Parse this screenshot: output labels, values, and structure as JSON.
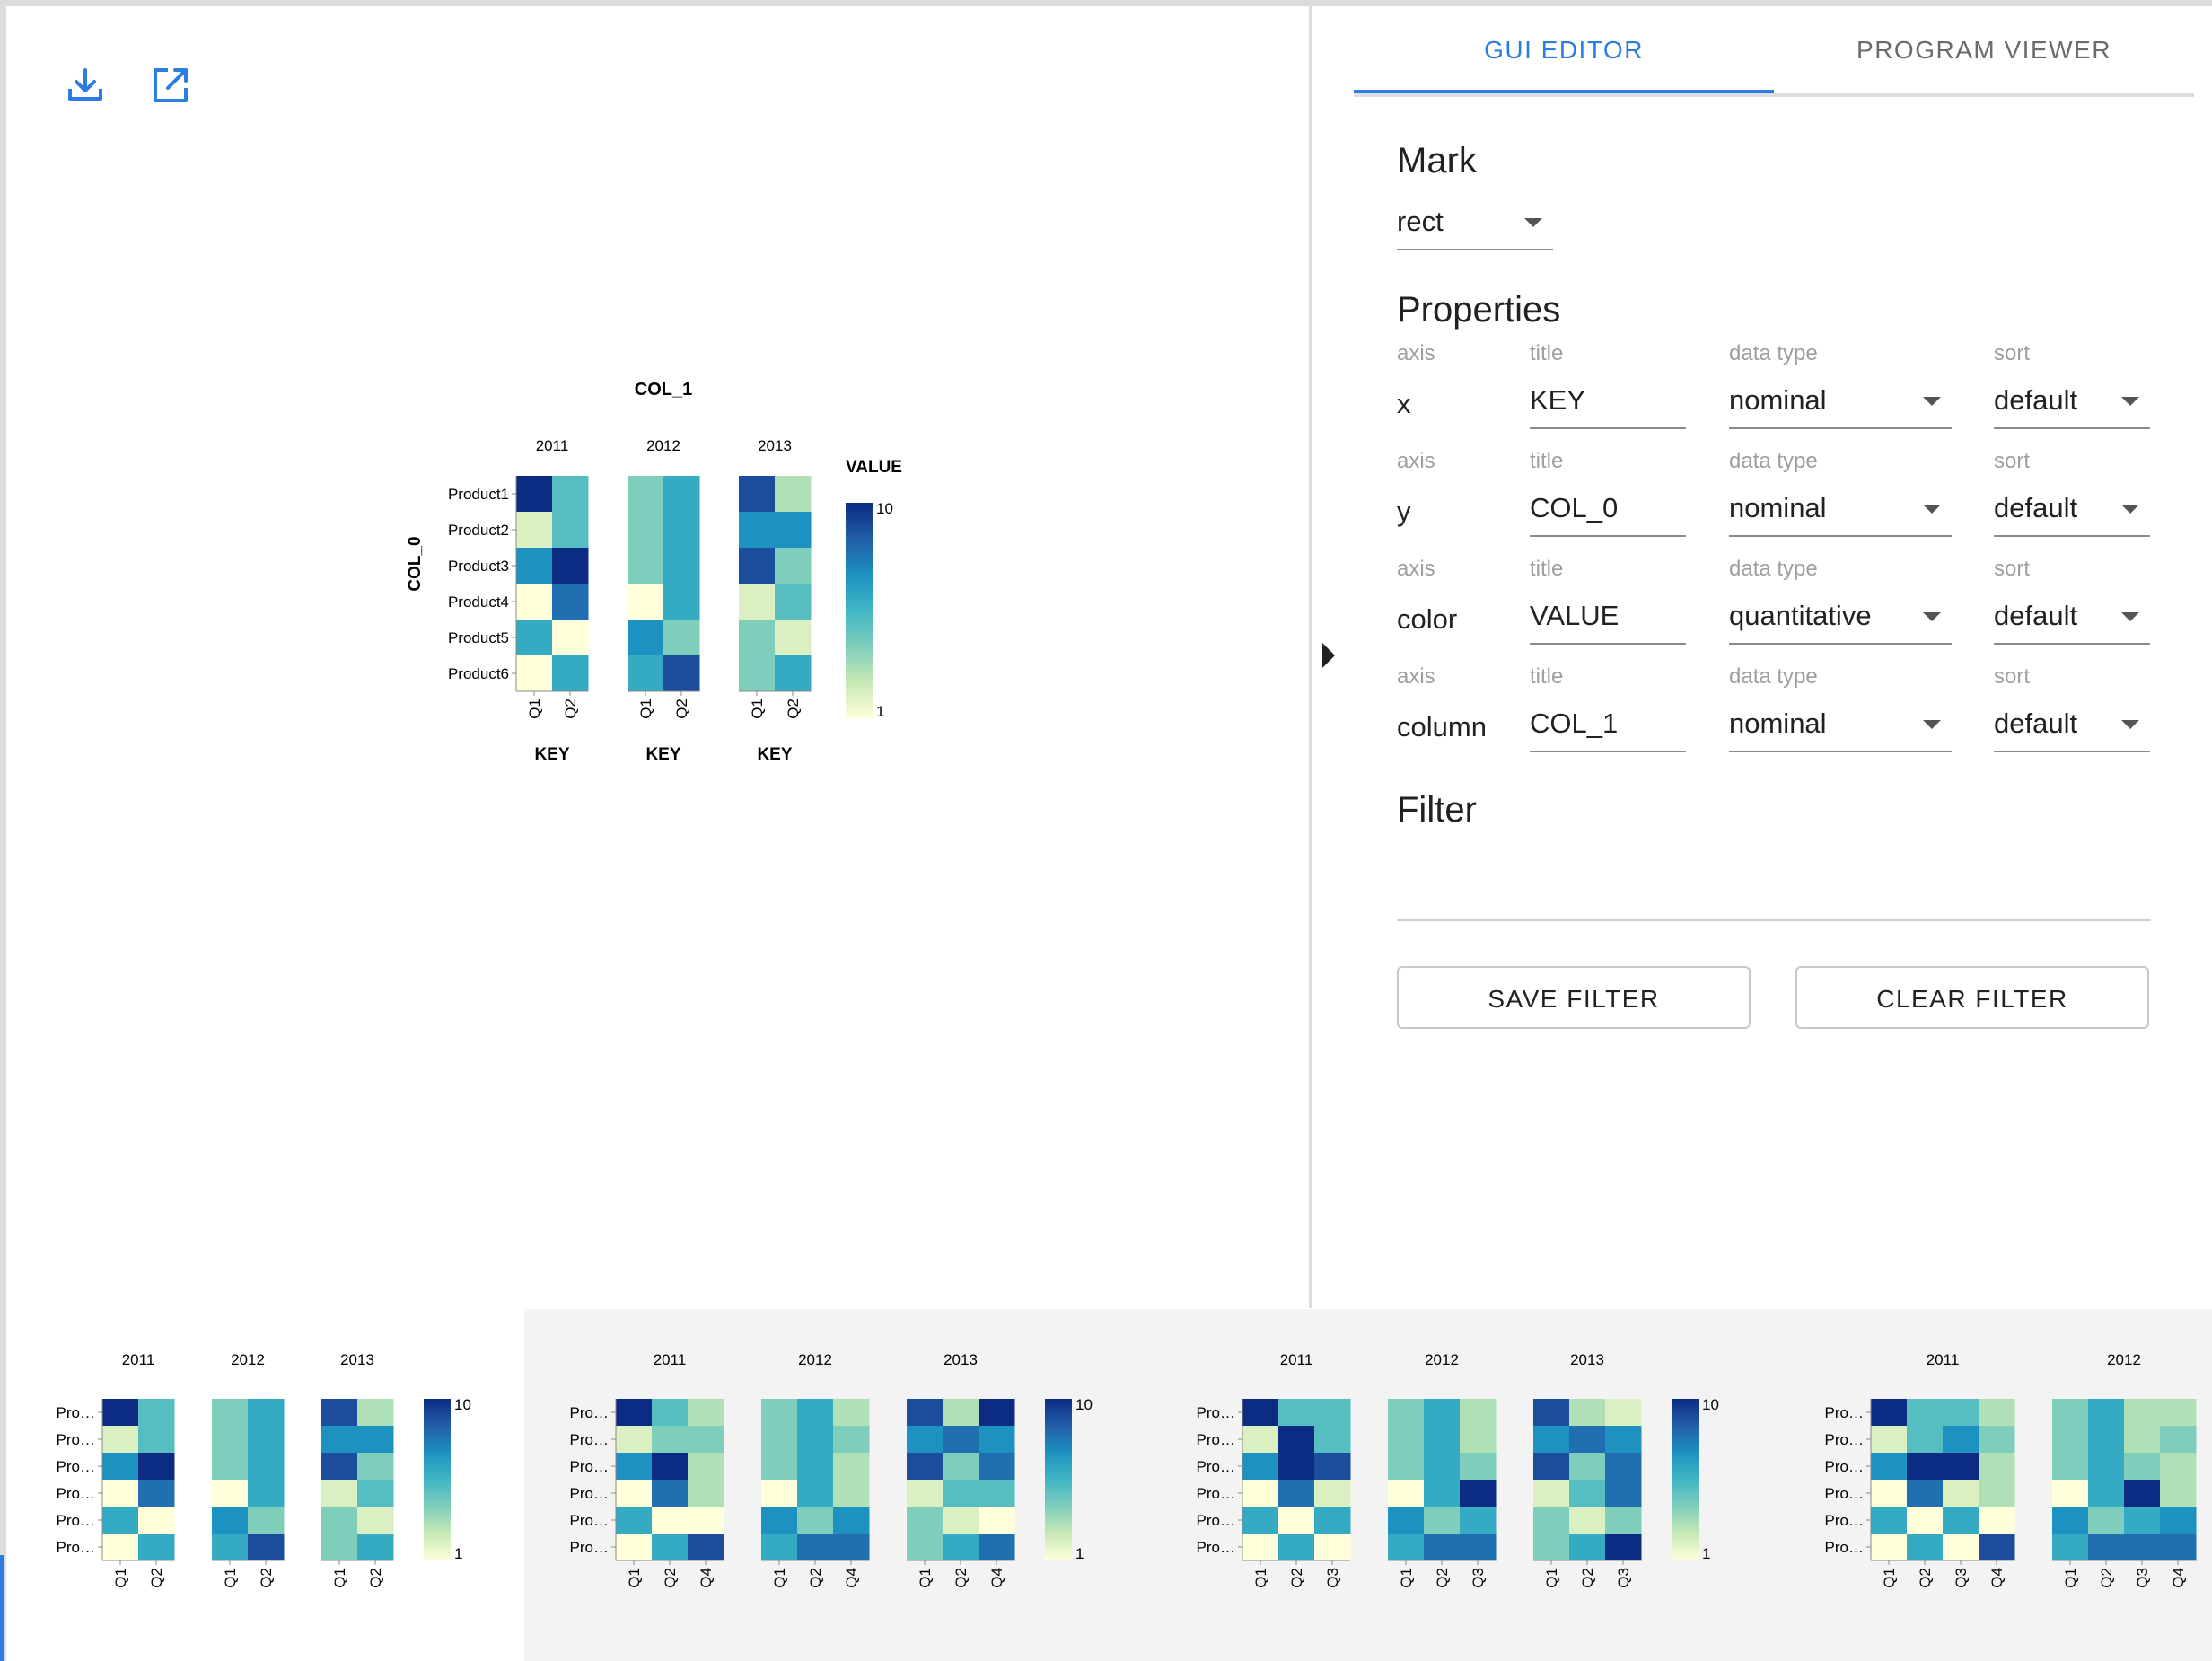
{
  "toolbar": {
    "download_icon": "download-icon",
    "open_icon": "open-in-new-icon",
    "accent": "#2b7de1"
  },
  "tabs": [
    {
      "label": "GUI EDITOR",
      "active": true
    },
    {
      "label": "PROGRAM VIEWER",
      "active": false
    }
  ],
  "editor": {
    "mark_title": "Mark",
    "mark_value": "rect",
    "properties_title": "Properties",
    "col_labels": {
      "axis": "axis",
      "title": "title",
      "data_type": "data type",
      "sort": "sort"
    },
    "rows": [
      {
        "axis": "x",
        "title": "KEY",
        "data_type": "nominal",
        "sort": "default"
      },
      {
        "axis": "y",
        "title": "COL_0",
        "data_type": "nominal",
        "sort": "default"
      },
      {
        "axis": "color",
        "title": "VALUE",
        "data_type": "quantitative",
        "sort": "default"
      },
      {
        "axis": "column",
        "title": "COL_1",
        "data_type": "nominal",
        "sort": "default"
      }
    ],
    "filter_title": "Filter",
    "save_filter": "SAVE FILTER",
    "clear_filter": "CLEAR FILTER"
  },
  "color_scale": [
    "#ffffd9",
    "#c7e9b4",
    "#7fcdbb",
    "#41b6c4",
    "#1d91c0",
    "#225ea8",
    "#0c2c84"
  ],
  "chart_data": {
    "type": "heatmap",
    "title": "COL_1",
    "xlabel": "KEY",
    "ylabel": "COL_0",
    "legend_title": "VALUE",
    "legend_range": [
      1,
      10
    ],
    "legend_tick_labels": [
      "10",
      "1"
    ],
    "rows": [
      "Product1",
      "Product2",
      "Product3",
      "Product4",
      "Product5",
      "Product6"
    ],
    "facets": [
      {
        "name": "2011",
        "keys": [
          "Q1",
          "Q2"
        ],
        "values": [
          [
            10,
            5
          ],
          [
            2,
            5
          ],
          [
            7,
            10
          ],
          [
            1,
            8
          ],
          [
            6,
            1
          ],
          [
            1,
            6
          ]
        ]
      },
      {
        "name": "2012",
        "keys": [
          "Q1",
          "Q2"
        ],
        "values": [
          [
            4,
            6
          ],
          [
            4,
            6
          ],
          [
            4,
            6
          ],
          [
            1,
            6
          ],
          [
            7,
            4
          ],
          [
            6,
            9
          ]
        ]
      },
      {
        "name": "2013",
        "keys": [
          "Q1",
          "Q2"
        ],
        "values": [
          [
            9,
            3
          ],
          [
            7,
            7
          ],
          [
            9,
            4
          ],
          [
            2,
            5
          ],
          [
            4,
            2
          ],
          [
            4,
            6
          ]
        ]
      }
    ]
  },
  "gallery": [
    {
      "row_label": "Pro…",
      "legend_tick_labels": [
        "10",
        "1"
      ],
      "facets": [
        {
          "name": "2011",
          "keys": [
            "Q1",
            "Q2"
          ],
          "values": [
            [
              10,
              5
            ],
            [
              2,
              5
            ],
            [
              7,
              10
            ],
            [
              1,
              8
            ],
            [
              6,
              1
            ],
            [
              1,
              6
            ]
          ]
        },
        {
          "name": "2012",
          "keys": [
            "Q1",
            "Q2"
          ],
          "values": [
            [
              4,
              6
            ],
            [
              4,
              6
            ],
            [
              4,
              6
            ],
            [
              1,
              6
            ],
            [
              7,
              4
            ],
            [
              6,
              9
            ]
          ]
        },
        {
          "name": "2013",
          "keys": [
            "Q1",
            "Q2"
          ],
          "values": [
            [
              9,
              3
            ],
            [
              7,
              7
            ],
            [
              9,
              4
            ],
            [
              2,
              5
            ],
            [
              4,
              2
            ],
            [
              4,
              6
            ]
          ]
        }
      ]
    },
    {
      "row_label": "Pro…",
      "legend_tick_labels": [
        "10",
        "1"
      ],
      "facets": [
        {
          "name": "2011",
          "keys": [
            "Q1",
            "Q2",
            "Q4"
          ],
          "values": [
            [
              10,
              5,
              3
            ],
            [
              2,
              4,
              4
            ],
            [
              7,
              10,
              3
            ],
            [
              1,
              8,
              3
            ],
            [
              6,
              1,
              1
            ],
            [
              1,
              6,
              9
            ]
          ]
        },
        {
          "name": "2012",
          "keys": [
            "Q1",
            "Q2",
            "Q4"
          ],
          "values": [
            [
              4,
              6,
              3
            ],
            [
              4,
              6,
              4
            ],
            [
              4,
              6,
              3
            ],
            [
              1,
              6,
              3
            ],
            [
              7,
              4,
              7
            ],
            [
              6,
              8,
              8
            ]
          ]
        },
        {
          "name": "2013",
          "keys": [
            "Q1",
            "Q2",
            "Q4"
          ],
          "values": [
            [
              9,
              3,
              10
            ],
            [
              7,
              8,
              7
            ],
            [
              9,
              4,
              8
            ],
            [
              2,
              5,
              5
            ],
            [
              4,
              2,
              1
            ],
            [
              4,
              6,
              8
            ]
          ]
        }
      ]
    },
    {
      "row_label": "Pro…",
      "legend_tick_labels": [
        "10",
        "1"
      ],
      "facets": [
        {
          "name": "2011",
          "keys": [
            "Q1",
            "Q2",
            "Q3"
          ],
          "values": [
            [
              10,
              5,
              5
            ],
            [
              2,
              10,
              5
            ],
            [
              7,
              10,
              9
            ],
            [
              1,
              8,
              2
            ],
            [
              6,
              1,
              6
            ],
            [
              1,
              6,
              1
            ]
          ]
        },
        {
          "name": "2012",
          "keys": [
            "Q1",
            "Q2",
            "Q3"
          ],
          "values": [
            [
              4,
              6,
              3
            ],
            [
              4,
              6,
              3
            ],
            [
              4,
              6,
              4
            ],
            [
              1,
              6,
              10
            ],
            [
              7,
              4,
              6
            ],
            [
              6,
              8,
              8
            ]
          ]
        },
        {
          "name": "2013",
          "keys": [
            "Q1",
            "Q2",
            "Q3"
          ],
          "values": [
            [
              9,
              3,
              2
            ],
            [
              7,
              8,
              7
            ],
            [
              9,
              4,
              8
            ],
            [
              2,
              5,
              8
            ],
            [
              4,
              2,
              4
            ],
            [
              4,
              6,
              10
            ]
          ]
        }
      ]
    },
    {
      "row_label": "Pro…",
      "legend_tick_labels": [],
      "facets": [
        {
          "name": "2011",
          "keys": [
            "Q1",
            "Q2",
            "Q3",
            "Q4"
          ],
          "values": [
            [
              10,
              5,
              5,
              3
            ],
            [
              2,
              5,
              7,
              4
            ],
            [
              7,
              10,
              10,
              3
            ],
            [
              1,
              8,
              2,
              3
            ],
            [
              6,
              1,
              6,
              1
            ],
            [
              1,
              6,
              1,
              9
            ]
          ]
        },
        {
          "name": "2012",
          "keys": [
            "Q1",
            "Q2",
            "Q3",
            "Q4"
          ],
          "values": [
            [
              4,
              6,
              3,
              3
            ],
            [
              4,
              6,
              3,
              4
            ],
            [
              4,
              6,
              4,
              3
            ],
            [
              1,
              6,
              10,
              3
            ],
            [
              7,
              4,
              6,
              7
            ],
            [
              6,
              8,
              8,
              8
            ]
          ]
        }
      ]
    }
  ]
}
